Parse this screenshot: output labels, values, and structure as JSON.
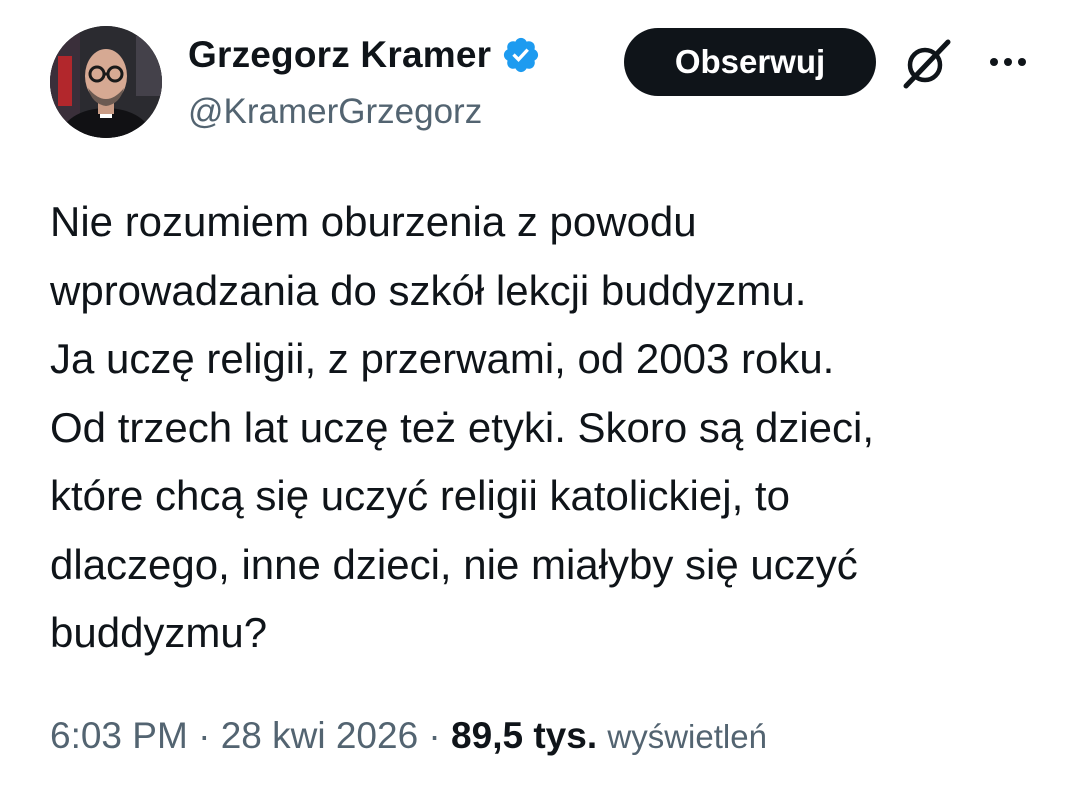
{
  "author": {
    "display_name": "Grzegorz Kramer",
    "handle": "@KramerGrzegorz",
    "verified": true,
    "verified_color": "#1d9bf0"
  },
  "actions": {
    "follow_label": "Obserwuj",
    "grok_icon": "grok-icon",
    "more_icon": "more-icon"
  },
  "tweet": {
    "lines": [
      "Nie rozumiem oburzenia z powodu",
      "wprowadzania do szkół lekcji buddyzmu.",
      "Ja uczę religii, z przerwami, od 2003 roku.",
      "Od trzech lat uczę też etyki. Skoro są dzieci,",
      "które chcą się uczyć religii katolickiej, to",
      "dlaczego, inne dzieci, nie miałyby się uczyć",
      "buddyzmu?"
    ]
  },
  "meta": {
    "time": "6:03 PM",
    "separator": " · ",
    "date": "28 kwi 2026",
    "views_count": "89,5 tys.",
    "views_label": "wyświetleń"
  },
  "colors": {
    "text": "#0f1419",
    "secondary": "#536471",
    "button_bg": "#0f1419",
    "button_text": "#ffffff"
  }
}
